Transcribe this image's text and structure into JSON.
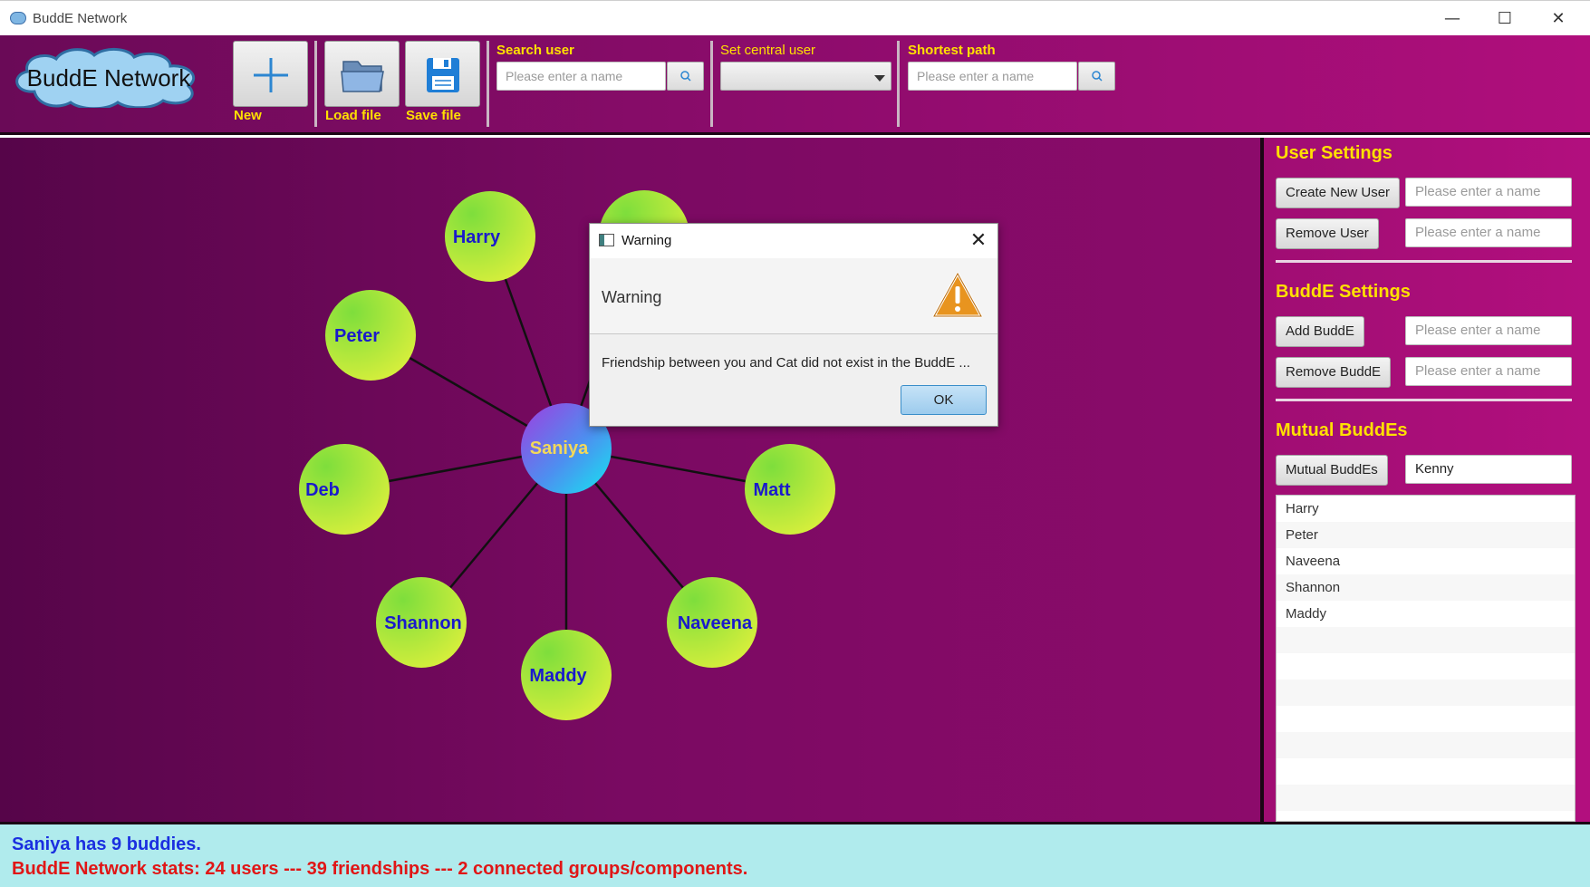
{
  "window": {
    "title": "BuddE Network",
    "controls": {
      "minimize": "—",
      "maximize": "☐",
      "close": "✕"
    }
  },
  "toolbar": {
    "logo_text": "BuddE Network",
    "new_label": "New",
    "load_label": "Load file",
    "save_label": "Save file",
    "search_user_caption": "Search user",
    "search_user_placeholder": "Please enter a name",
    "central_user_caption": "Set central user",
    "central_user_value": "",
    "shortest_path_caption": "Shortest path",
    "shortest_path_placeholder": "Please enter a name",
    "search_icon": "search-icon"
  },
  "graph": {
    "central": {
      "name": "Saniya"
    },
    "buddies": [
      "Harry",
      "Peter",
      "Deb",
      "Shannon",
      "Maddy",
      "Naveena",
      "Matt",
      ""
    ],
    "colors": {
      "central_label": "#ffe600",
      "buddy_label": "#1a1acc",
      "edge": "#111111"
    }
  },
  "settings": {
    "user_heading": "User Settings",
    "create_user_label": "Create New User",
    "create_user_placeholder": "Please enter a name",
    "remove_user_label": "Remove User",
    "remove_user_placeholder": "Please enter a name",
    "budde_heading": "BuddE Settings",
    "add_budde_label": "Add BuddE",
    "add_budde_placeholder": "Please enter a name",
    "remove_budde_label": "Remove BuddE",
    "remove_budde_placeholder": "Please enter a name",
    "mutual_heading": "Mutual BuddEs",
    "mutual_button_label": "Mutual BuddEs",
    "mutual_input_value": "Kenny",
    "mutual_list": [
      "Harry",
      "Peter",
      "Naveena",
      "Shannon",
      "Maddy"
    ]
  },
  "status": {
    "line1": "Saniya has 9 buddies.",
    "line2": "BuddE Network stats: 24 users --- 39 friendships --- 2 connected groups/components."
  },
  "dialog": {
    "title": "Warning",
    "header": "Warning",
    "message": "Friendship between you and Cat did not exist in the BuddE ...",
    "ok_label": "OK",
    "close_glyph": "✕",
    "icon": "warning-triangle-icon"
  }
}
